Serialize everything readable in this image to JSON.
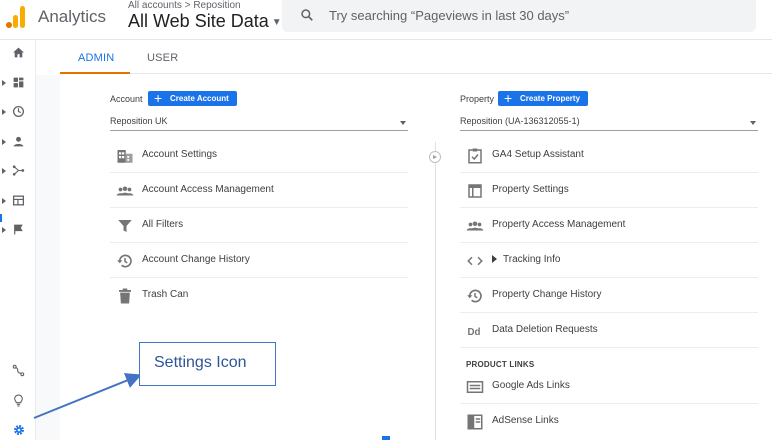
{
  "header": {
    "app_name": "Analytics",
    "breadcrumb": "All accounts > Reposition",
    "property_title": "All Web Site Data",
    "search_placeholder": "Try searching “Pageviews in last 30 days”"
  },
  "tabs": [
    {
      "label": "ADMIN",
      "active": true
    },
    {
      "label": "USER",
      "active": false
    }
  ],
  "account": {
    "label": "Account",
    "create_label": "Create Account",
    "selected": "Reposition UK",
    "items": [
      {
        "label": "Account Settings",
        "icon": "building-icon"
      },
      {
        "label": "Account Access Management",
        "icon": "people-icon"
      },
      {
        "label": "All Filters",
        "icon": "filter-icon"
      },
      {
        "label": "Account Change History",
        "icon": "history-icon"
      },
      {
        "label": "Trash Can",
        "icon": "trash-icon"
      }
    ]
  },
  "property": {
    "label": "Property",
    "create_label": "Create Property",
    "selected": "Reposition (UA-136312055-1)",
    "items": [
      {
        "label": "GA4 Setup Assistant",
        "icon": "checklist-icon"
      },
      {
        "label": "Property Settings",
        "icon": "window-icon"
      },
      {
        "label": "Property Access Management",
        "icon": "people-icon"
      },
      {
        "label": "Tracking Info",
        "icon": "code-icon"
      },
      {
        "label": "Property Change History",
        "icon": "history-icon"
      },
      {
        "label": "Data Deletion Requests",
        "icon": "dd-icon"
      }
    ],
    "product_links_label": "PRODUCT LINKS",
    "product_links": [
      {
        "label": "Google Ads Links",
        "icon": "ads-icon"
      },
      {
        "label": "AdSense Links",
        "icon": "adsense-icon"
      }
    ]
  },
  "annotation": {
    "text": "Settings Icon",
    "color": "#4472c4"
  },
  "colors": {
    "accent": "#1a73e8",
    "tab_underline": "#e37400"
  }
}
